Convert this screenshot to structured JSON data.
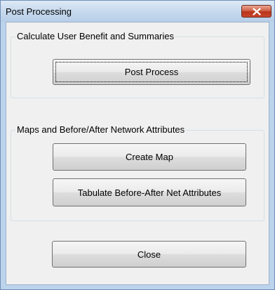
{
  "window": {
    "title": "Post Processing"
  },
  "groups": {
    "benefit": {
      "label": "Calculate User Benefit and Summaries",
      "post_process_label": "Post Process"
    },
    "maps": {
      "label": "Maps and Before/After Network Attributes",
      "create_map_label": "Create Map",
      "tabulate_label": "Tabulate Before-After Net Attributes"
    }
  },
  "footer": {
    "close_label": "Close"
  },
  "colors": {
    "titlebar": "#c7daee",
    "close_button": "#c9482d",
    "dialog_face": "#f0f0f0"
  }
}
